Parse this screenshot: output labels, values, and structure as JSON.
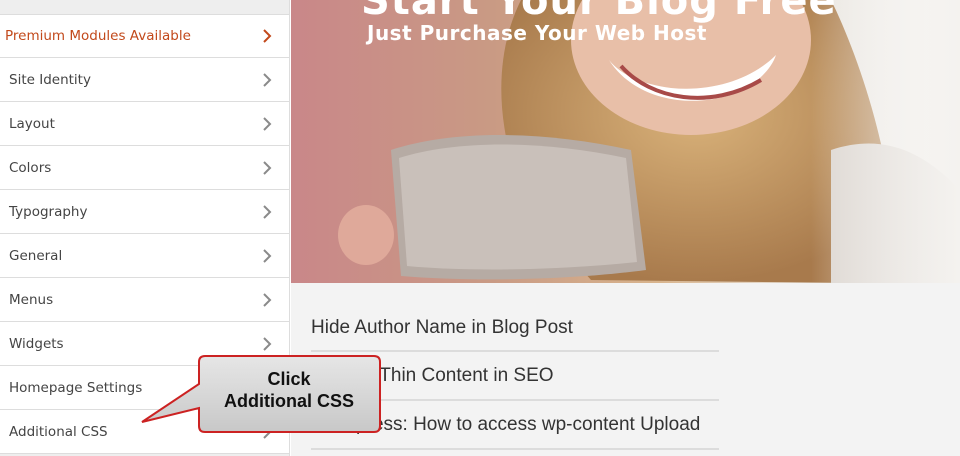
{
  "sidebar": {
    "items": [
      {
        "label": "Premium Modules Available"
      },
      {
        "label": "Site Identity"
      },
      {
        "label": "Layout"
      },
      {
        "label": "Colors"
      },
      {
        "label": "Typography"
      },
      {
        "label": "General"
      },
      {
        "label": "Menus"
      },
      {
        "label": "Widgets"
      },
      {
        "label": "Homepage Settings"
      },
      {
        "label": "Additional CSS"
      }
    ],
    "premium_color": "#c2491b"
  },
  "preview": {
    "hero": {
      "title": "Start Your Blog Free",
      "subtitle": "Just Purchase Your Web Host"
    },
    "posts": [
      "Hide Author Name in Blog Post",
      "What is Thin Content in SEO",
      "Wordpress: How to access wp-content Upload"
    ]
  },
  "callout": {
    "line1": "Click",
    "line2": "Additional CSS",
    "border_color": "#cc2222"
  }
}
